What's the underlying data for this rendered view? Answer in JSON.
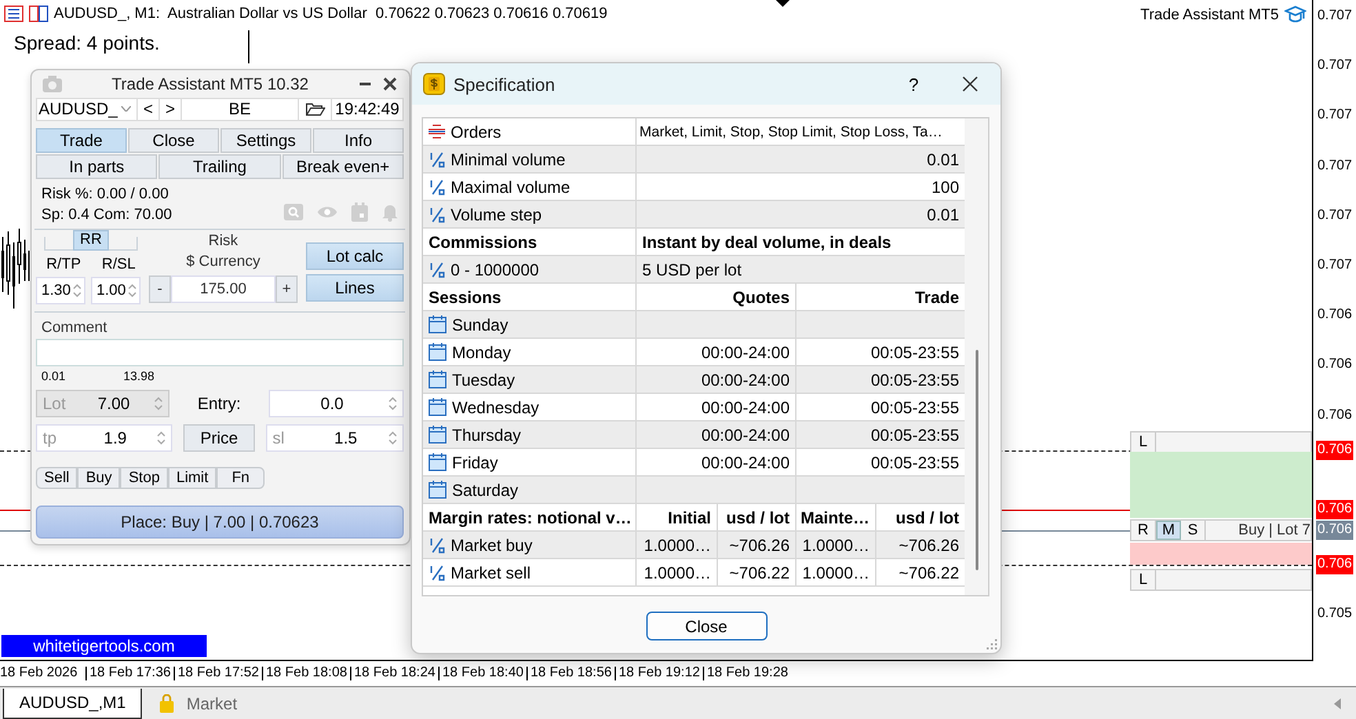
{
  "chart": {
    "symbol_line": "AUDUSD_, M1:  Australian Dollar vs US Dollar  0.70622 0.70623 0.70616 0.70619",
    "spread": "Spread: 4 points.",
    "indicator_name": "Trade Assistant MT5",
    "watermark": "whitetigertools.com",
    "price_ticks": [
      "0.707",
      "0.707",
      "0.707",
      "0.707",
      "0.707",
      "0.707",
      "0.706",
      "0.706",
      "0.706",
      "0.705"
    ],
    "price_tags": [
      {
        "text": "0.706",
        "color": "#ff0000"
      },
      {
        "text": "0.706",
        "color": "#ff0000"
      },
      {
        "text": "0.706",
        "color": "#778899"
      },
      {
        "text": "0.706",
        "color": "#ff0000"
      }
    ],
    "time_labels": [
      "18 Feb 2026",
      "18 Feb 17:36",
      "18 Feb 17:52",
      "18 Feb 18:08",
      "18 Feb 18:24",
      "18 Feb 18:40",
      "18 Feb 18:56",
      "18 Feb 19:12",
      "18 Feb 19:28"
    ],
    "trade_widget": {
      "top_label": "L",
      "buttons": [
        {
          "label": "R",
          "selected": false
        },
        {
          "label": "M",
          "selected": true
        },
        {
          "label": "S",
          "selected": false
        }
      ],
      "info": "Buy | Lot 7",
      "bottom_label": "L"
    }
  },
  "assistant": {
    "title": "Trade Assistant MT5 10.32",
    "symbol": "AUDUSD_",
    "prev": "<",
    "next": ">",
    "be": "BE",
    "time": "19:42:49",
    "tabs": [
      {
        "label": "Trade",
        "selected": true
      },
      {
        "label": "Close",
        "selected": false
      },
      {
        "label": "Settings",
        "selected": false
      },
      {
        "label": "Info",
        "selected": false
      }
    ],
    "subtabs": [
      {
        "label": "In parts",
        "selected": false
      },
      {
        "label": "Trailing",
        "selected": false
      },
      {
        "label": "Break even+",
        "selected": false
      }
    ],
    "risk_line": "Risk %: 0.00 /  0.00",
    "sp_line": "Sp: 0.4  Com: 70.00",
    "rr": {
      "label": "RR",
      "selected": true
    },
    "rtp_label": "R/TP",
    "rsl_label": "R/SL",
    "rtp": "1.30",
    "rsl": "1.00",
    "risk_label": "Risk",
    "currency_label": "$ Currency",
    "minus": "-",
    "risk_value": "175.00",
    "plus": "+",
    "lot_calc": "Lot calc",
    "lines": "Lines",
    "comment_label": "Comment",
    "lot_min": "0.01",
    "lot_max": "13.98",
    "lot": {
      "label": "Lot",
      "value": "7.00",
      "disabled": true
    },
    "entry_label": "Entry:",
    "entry": "0.0",
    "tp": {
      "label": "tp",
      "value": "1.9",
      "disabled": false
    },
    "price": "Price",
    "sl": {
      "label": "sl",
      "value": "1.5",
      "disabled": false
    },
    "order_types": [
      "Sell",
      "Buy",
      "Stop",
      "Limit",
      "Fn"
    ],
    "place": "Place: Buy | 7.00 | 0.70623"
  },
  "spec": {
    "title": "Specification",
    "help": "?",
    "rows": [
      {
        "kind": "orders",
        "cells": [
          "Orders",
          "Market, Limit, Stop, Stop Limit, Stop Loss, Ta…"
        ]
      },
      {
        "kind": "volume",
        "cells": [
          "Minimal volume",
          "0.01"
        ]
      },
      {
        "kind": "volume",
        "cells": [
          "Maximal volume",
          "100"
        ]
      },
      {
        "kind": "volume",
        "cells": [
          "Volume step",
          "0.01"
        ]
      },
      {
        "kind": "header",
        "cells": [
          "Commissions",
          "Instant by deal volume, in deals"
        ]
      },
      {
        "kind": "tier",
        "cells": [
          "0 - 1000000",
          "5 USD per lot"
        ]
      },
      {
        "kind": "header",
        "cells": [
          "Sessions",
          "Quotes",
          "Trade"
        ]
      },
      {
        "kind": "day",
        "cells": [
          "Sunday"
        ]
      },
      {
        "kind": "day",
        "cells": [
          "Monday",
          "00:00-24:00",
          "00:05-23:55"
        ]
      },
      {
        "kind": "day",
        "cells": [
          "Tuesday",
          "00:00-24:00",
          "00:05-23:55"
        ]
      },
      {
        "kind": "day",
        "cells": [
          "Wednesday",
          "00:00-24:00",
          "00:05-23:55"
        ]
      },
      {
        "kind": "day",
        "cells": [
          "Thursday",
          "00:00-24:00",
          "00:05-23:55"
        ]
      },
      {
        "kind": "day",
        "cells": [
          "Friday",
          "00:00-24:00",
          "00:05-23:55"
        ]
      },
      {
        "kind": "day",
        "cells": [
          "Saturday"
        ]
      },
      {
        "kind": "header",
        "cells": [
          "Margin rates: notional v…",
          "Initial",
          "usd / lot",
          "Mainte…",
          "usd / lot"
        ]
      },
      {
        "kind": "margin",
        "cells": [
          "Market buy",
          "1.0000…",
          "~706.26",
          "1.0000…",
          "~706.26"
        ]
      },
      {
        "kind": "margin",
        "cells": [
          "Market sell",
          "1.0000…",
          "~706.22",
          "1.0000…",
          "~706.22"
        ]
      }
    ],
    "close": "Close"
  },
  "tabs": [
    {
      "label": "AUDUSD_,M1",
      "selected": true
    },
    {
      "label": "Market",
      "selected": false
    }
  ]
}
